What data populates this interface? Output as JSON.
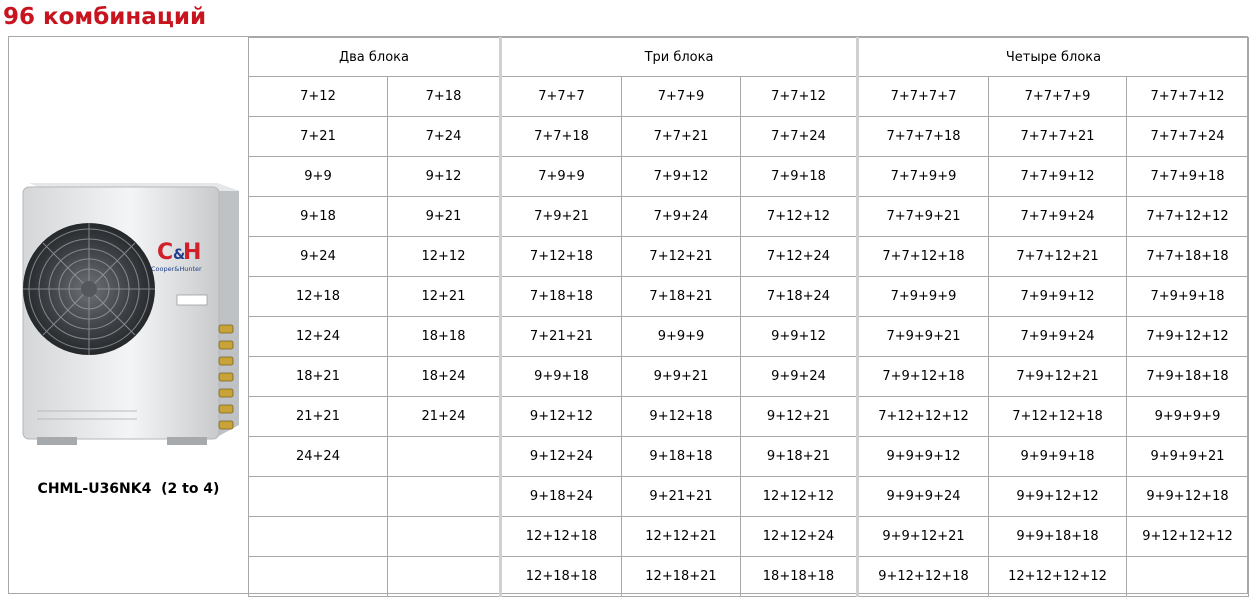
{
  "title": "96 комбинаций",
  "product": {
    "model": "CHML-U36NK4  (2 to 4)",
    "logo_mark": "C&H",
    "logo_text": "Cooper&Hunter",
    "image_icon": "outdoor-ac-unit-icon"
  },
  "colors": {
    "title": "#c8141e",
    "grid_border": "#a8a8a8",
    "logo_red": "#d0202a",
    "logo_blue": "#1f3d8a"
  },
  "groups": [
    {
      "label": "Два блока",
      "cols": 2
    },
    {
      "label": "Три блока",
      "cols": 3
    },
    {
      "label": "Четыре блока",
      "cols": 3
    }
  ],
  "rows": [
    [
      "7+12",
      "7+18",
      "7+7+7",
      "7+7+9",
      "7+7+12",
      "7+7+7+7",
      "7+7+7+9",
      "7+7+7+12"
    ],
    [
      "7+21",
      "7+24",
      "7+7+18",
      "7+7+21",
      "7+7+24",
      "7+7+7+18",
      "7+7+7+21",
      "7+7+7+24"
    ],
    [
      "9+9",
      "9+12",
      "7+9+9",
      "7+9+12",
      "7+9+18",
      "7+7+9+9",
      "7+7+9+12",
      "7+7+9+18"
    ],
    [
      "9+18",
      "9+21",
      "7+9+21",
      "7+9+24",
      "7+12+12",
      "7+7+9+21",
      "7+7+9+24",
      "7+7+12+12"
    ],
    [
      "9+24",
      "12+12",
      "7+12+18",
      "7+12+21",
      "7+12+24",
      "7+7+12+18",
      "7+7+12+21",
      "7+7+18+18"
    ],
    [
      "12+18",
      "12+21",
      "7+18+18",
      "7+18+21",
      "7+18+24",
      "7+9+9+9",
      "7+9+9+12",
      "7+9+9+18"
    ],
    [
      "12+24",
      "18+18",
      "7+21+21",
      "9+9+9",
      "9+9+12",
      "7+9+9+21",
      "7+9+9+24",
      "7+9+12+12"
    ],
    [
      "18+21",
      "18+24",
      "9+9+18",
      "9+9+21",
      "9+9+24",
      "7+9+12+18",
      "7+9+12+21",
      "7+9+18+18"
    ],
    [
      "21+21",
      "21+24",
      "9+12+12",
      "9+12+18",
      "9+12+21",
      "7+12+12+12",
      "7+12+12+18",
      "9+9+9+9"
    ],
    [
      "24+24",
      "",
      "9+12+24",
      "9+18+18",
      "9+18+21",
      "9+9+9+12",
      "9+9+9+18",
      "9+9+9+21"
    ],
    [
      "",
      "",
      "9+18+24",
      "9+21+21",
      "12+12+12",
      "9+9+9+24",
      "9+9+12+12",
      "9+9+12+18"
    ],
    [
      "",
      "",
      "12+12+18",
      "12+12+21",
      "12+12+24",
      "9+9+12+21",
      "9+9+18+18",
      "9+12+12+12"
    ],
    [
      "",
      "",
      "12+18+18",
      "12+18+21",
      "18+18+18",
      "9+12+12+18",
      "12+12+12+12",
      ""
    ]
  ]
}
